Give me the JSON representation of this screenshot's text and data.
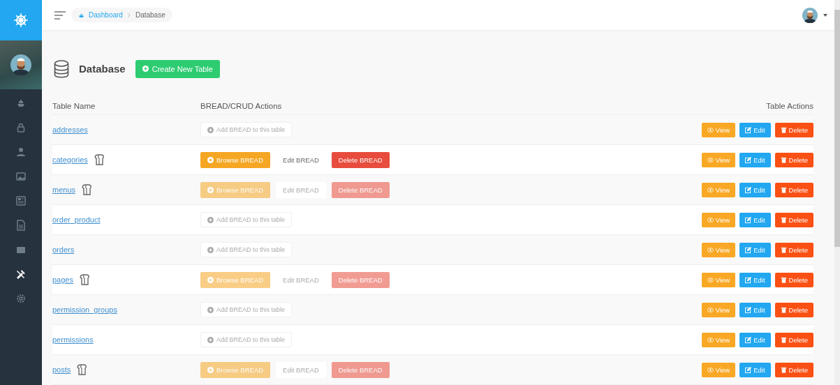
{
  "sidebar": {
    "items": [
      {
        "kind": "ship",
        "selected": false
      },
      {
        "kind": "lock",
        "selected": false
      },
      {
        "kind": "user",
        "selected": false
      },
      {
        "kind": "image",
        "selected": false
      },
      {
        "kind": "news",
        "selected": false
      },
      {
        "kind": "file",
        "selected": false
      },
      {
        "kind": "box",
        "selected": false
      },
      {
        "kind": "tools",
        "selected": true
      },
      {
        "kind": "gear",
        "selected": false
      }
    ]
  },
  "breadcrumb": [
    "Dashboard",
    "Database"
  ],
  "page": {
    "title": "Database",
    "create_button": "Create New Table"
  },
  "table": {
    "columns": [
      "Table Name",
      "BREAD/CRUD Actions",
      "Table Actions"
    ],
    "rows": [
      {
        "name": "addresses",
        "kind": "add",
        "add_label": "Add BREAD to this table",
        "actions": [
          "View",
          "Edit",
          "Delete"
        ]
      },
      {
        "name": "categories",
        "kind": "bread",
        "hovered": true,
        "browse": "Browse BREAD",
        "edit": "Edit BREAD",
        "delete": "Delete BREAD",
        "actions": [
          "View",
          "Edit",
          "Delete"
        ]
      },
      {
        "name": "menus",
        "kind": "bread",
        "hovered": false,
        "browse": "Browse BREAD",
        "edit": "Edit BREAD",
        "delete": "Delete BREAD",
        "actions": [
          "View",
          "Edit",
          "Delete"
        ]
      },
      {
        "name": "order_product",
        "kind": "add",
        "add_label": "Add BREAD to this table",
        "actions": [
          "View",
          "Edit",
          "Delete"
        ]
      },
      {
        "name": "orders",
        "kind": "add",
        "add_label": "Add BREAD to this table",
        "actions": [
          "View",
          "Edit",
          "Delete"
        ]
      },
      {
        "name": "pages",
        "kind": "bread",
        "hovered": false,
        "browse": "Browse BREAD",
        "edit": "Edit BREAD",
        "delete": "Delete BREAD",
        "actions": [
          "View",
          "Edit",
          "Delete"
        ]
      },
      {
        "name": "permission_groups",
        "kind": "add",
        "add_label": "Add BREAD to this table",
        "actions": [
          "View",
          "Edit",
          "Delete"
        ]
      },
      {
        "name": "permissions",
        "kind": "add",
        "add_label": "Add BREAD to this table",
        "actions": [
          "View",
          "Edit",
          "Delete"
        ]
      },
      {
        "name": "posts",
        "kind": "bread",
        "hovered": false,
        "browse": "Browse BREAD",
        "edit": "Edit BREAD",
        "delete": "Delete BREAD",
        "actions": [
          "View",
          "Edit",
          "Delete"
        ]
      }
    ]
  }
}
